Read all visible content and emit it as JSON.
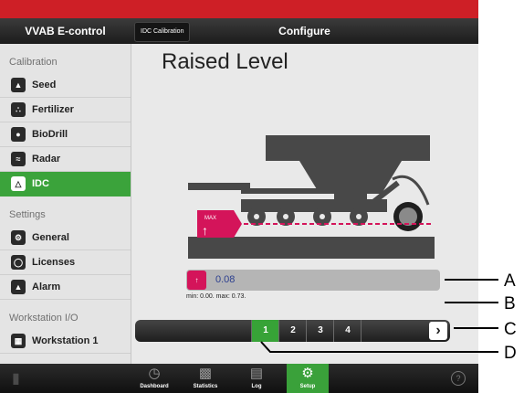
{
  "app_title": "VVAB E-control",
  "breadcrumb": "IDC Calibration",
  "page_title": "Configure",
  "heading": "Raised Level",
  "sidebar": {
    "sections": [
      {
        "title": "Calibration",
        "items": [
          {
            "label": "Seed",
            "icon": "seed-icon",
            "active": false
          },
          {
            "label": "Fertilizer",
            "icon": "fertilizer-icon",
            "active": false
          },
          {
            "label": "BioDrill",
            "icon": "drop-icon",
            "active": false
          },
          {
            "label": "Radar",
            "icon": "radar-icon",
            "active": false
          },
          {
            "label": "IDC",
            "icon": "idc-icon",
            "active": true
          }
        ]
      },
      {
        "title": "Settings",
        "items": [
          {
            "label": "General",
            "icon": "gears-icon",
            "active": false
          },
          {
            "label": "Licenses",
            "icon": "license-icon",
            "active": false
          },
          {
            "label": "Alarm",
            "icon": "alarm-icon",
            "active": false
          }
        ]
      },
      {
        "title": "Workstation I/O",
        "items": [
          {
            "label": "Workstation 1",
            "icon": "workstation-icon",
            "active": false
          }
        ]
      }
    ]
  },
  "illustration": {
    "badge_text": "MAX"
  },
  "value_field": {
    "value": "0.08",
    "range_text": "min: 0.00. max: 0.73."
  },
  "steps": {
    "items": [
      "1",
      "2",
      "3",
      "4"
    ],
    "active": "1"
  },
  "bottom_tabs": [
    {
      "label": "Dashboard",
      "icon": "speedometer-icon",
      "active": false
    },
    {
      "label": "Statistics",
      "icon": "bar-chart-icon",
      "active": false
    },
    {
      "label": "Log",
      "icon": "document-icon",
      "active": false
    },
    {
      "label": "Setup",
      "icon": "gears-icon",
      "active": true
    }
  ],
  "help_symbol": "?",
  "callouts": [
    "A",
    "B",
    "C",
    "D"
  ],
  "colors": {
    "accent_green": "#3ba33b",
    "brand_red": "#ce1f26",
    "marker_magenta": "#d4145a"
  }
}
